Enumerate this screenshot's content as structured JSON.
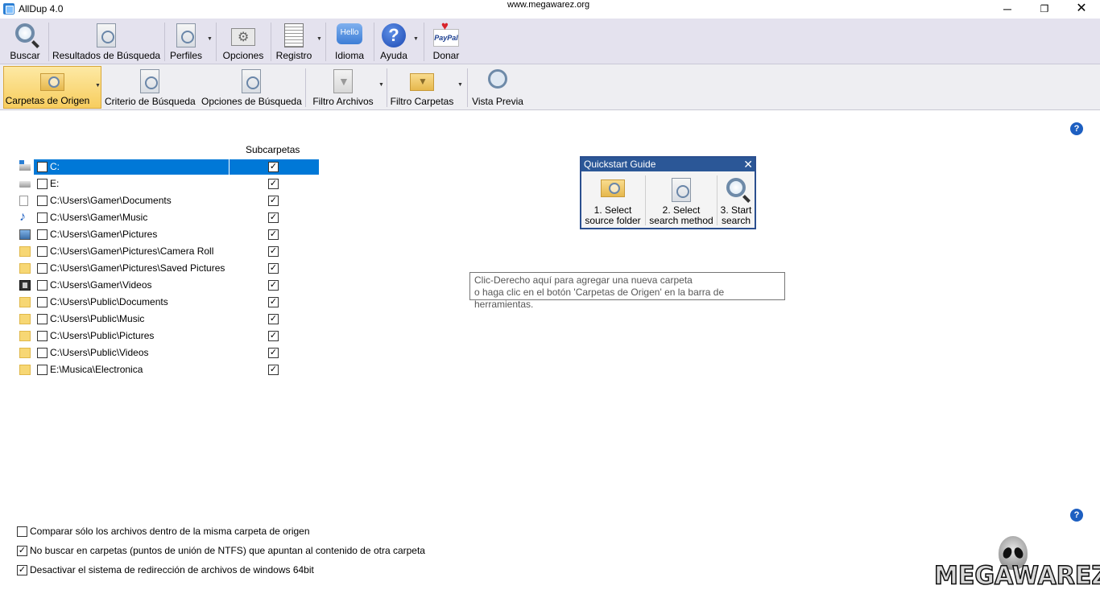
{
  "window": {
    "title": "AllDup 4.0",
    "watermark": "www.megawarez.org",
    "minimize": "─",
    "maximize": "❐",
    "close": "✕"
  },
  "toolbar_main": {
    "items": [
      {
        "label": "Buscar",
        "icon": "search-icon"
      },
      {
        "label": "Resultados de Búsqueda",
        "icon": "results-icon"
      },
      {
        "label": "Perfiles",
        "icon": "profiles-icon"
      },
      {
        "label": "Opciones",
        "icon": "options-icon"
      },
      {
        "label": "Registro",
        "icon": "log-icon"
      },
      {
        "label": "Idioma",
        "icon": "language-icon",
        "icon_text": "Hello"
      },
      {
        "label": "Ayuda",
        "icon": "help-icon",
        "icon_text": "?"
      },
      {
        "label": "Donar",
        "icon": "paypal-icon",
        "icon_text": "PayPal"
      }
    ]
  },
  "toolbar_search": {
    "items": [
      {
        "label": "Carpetas de Origen",
        "icon": "source-folder-icon",
        "active": true
      },
      {
        "label": "Criterio de Búsqueda",
        "icon": "search-criteria-icon"
      },
      {
        "label": "Opciones de Búsqueda",
        "icon": "search-options-icon"
      },
      {
        "label": "Filtro Archivos",
        "icon": "file-filter-icon"
      },
      {
        "label": "Filtro Carpetas",
        "icon": "folder-filter-icon"
      },
      {
        "label": "Vista Previa",
        "icon": "preview-icon"
      }
    ]
  },
  "help_glyph": "?",
  "folder_list": {
    "subfolders_header": "Subcarpetas",
    "rows": [
      {
        "path": "C:",
        "icon": "windows-drive-icon",
        "checked": false,
        "subfolders": true,
        "selected": true
      },
      {
        "path": "E:",
        "icon": "drive-icon",
        "checked": false,
        "subfolders": true
      },
      {
        "path": "C:\\Users\\Gamer\\Documents",
        "icon": "documents-icon",
        "checked": false,
        "subfolders": true
      },
      {
        "path": "C:\\Users\\Gamer\\Music",
        "icon": "music-icon",
        "checked": false,
        "subfolders": true
      },
      {
        "path": "C:\\Users\\Gamer\\Pictures",
        "icon": "pictures-icon",
        "checked": false,
        "subfolders": true
      },
      {
        "path": "C:\\Users\\Gamer\\Pictures\\Camera Roll",
        "icon": "folder-icon",
        "checked": false,
        "subfolders": true
      },
      {
        "path": "C:\\Users\\Gamer\\Pictures\\Saved Pictures",
        "icon": "folder-icon",
        "checked": false,
        "subfolders": true
      },
      {
        "path": "C:\\Users\\Gamer\\Videos",
        "icon": "videos-icon",
        "checked": false,
        "subfolders": true
      },
      {
        "path": "C:\\Users\\Public\\Documents",
        "icon": "folder-icon",
        "checked": false,
        "subfolders": true
      },
      {
        "path": "C:\\Users\\Public\\Music",
        "icon": "folder-icon",
        "checked": false,
        "subfolders": true
      },
      {
        "path": "C:\\Users\\Public\\Pictures",
        "icon": "folder-icon",
        "checked": false,
        "subfolders": true
      },
      {
        "path": "C:\\Users\\Public\\Videos",
        "icon": "folder-icon",
        "checked": false,
        "subfolders": true
      },
      {
        "path": "E:\\Musica\\Electronica",
        "icon": "folder-icon",
        "checked": false,
        "subfolders": true
      }
    ]
  },
  "quickstart": {
    "title": "Quickstart Guide",
    "close": "✕",
    "steps": [
      {
        "line1": "1. Select",
        "line2": "source folder",
        "icon": "source-folder-icon"
      },
      {
        "line1": "2. Select",
        "line2": "search method",
        "icon": "search-method-icon"
      },
      {
        "line1": "3. Start",
        "line2": "search",
        "icon": "start-search-icon"
      }
    ]
  },
  "tooltip": {
    "line1": "Clic-Derecho aquí para agregar una nueva carpeta",
    "line2": "o haga clic en el botón 'Carpetas de Origen' en la barra de herramientas."
  },
  "options": [
    {
      "label": "Comparar sólo los archivos dentro de la misma carpeta de origen",
      "checked": false
    },
    {
      "label": "No buscar en carpetas (puntos de unión de NTFS) que apuntan al contenido de otra carpeta",
      "checked": true
    },
    {
      "label": "Desactivar el sistema de redirección de archivos de windows 64bit",
      "checked": true
    }
  ],
  "logo": {
    "text": "MEGAWAREZ"
  },
  "check_glyph": "✓"
}
